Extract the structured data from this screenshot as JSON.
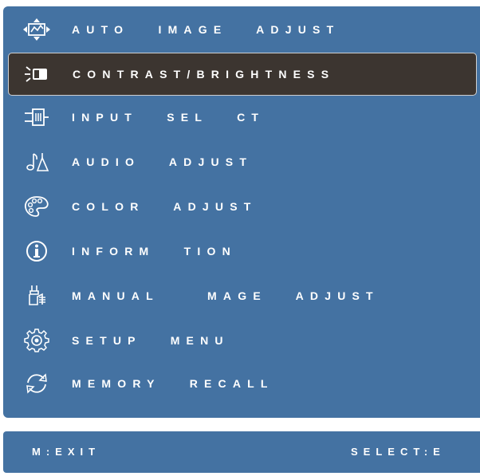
{
  "menu": {
    "items": [
      {
        "label": "AUTO   IMAGE   ADJUST",
        "icon": "auto-adjust-icon",
        "selected": false
      },
      {
        "label": "CONTRAST/BRIGHTNESS",
        "icon": "contrast-brightness-icon",
        "selected": true
      },
      {
        "label": "INPUT   SEL   CT",
        "icon": "input-select-icon",
        "selected": false
      },
      {
        "label": "AUDIO   ADJUST",
        "icon": "audio-icon",
        "selected": false
      },
      {
        "label": "COLOR   ADJUST",
        "icon": "color-palette-icon",
        "selected": false
      },
      {
        "label": "INFORM   TION",
        "icon": "info-icon",
        "selected": false
      },
      {
        "label": "MANUAL     MAGE   ADJUST",
        "icon": "manual-adjust-icon",
        "selected": false
      },
      {
        "label": "SETUP   MENU",
        "icon": "gear-icon",
        "selected": false
      },
      {
        "label": "MEMORY   RECALL",
        "icon": "recall-icon",
        "selected": false
      }
    ]
  },
  "footer": {
    "left": "M:EXIT",
    "right": "SELECT:E"
  },
  "colors": {
    "panel": "#4472a2",
    "selected": "#3c3530",
    "text": "#ffffff"
  }
}
